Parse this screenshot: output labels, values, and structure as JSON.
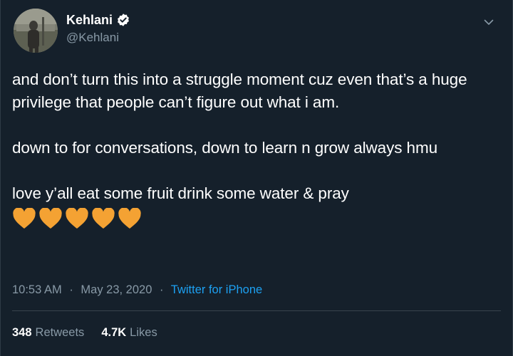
{
  "user": {
    "display_name": "Kehlani",
    "handle": "@Kehlani",
    "verified": true,
    "avatar_icon": "profile-photo"
  },
  "tweet": {
    "paragraphs": [
      "and don’t turn this into a struggle moment cuz even that’s a huge privilege that people can’t figure out what i am.",
      "down to for conversations, down to learn n grow always hmu",
      "love y’all eat some fruit drink some water & pray"
    ],
    "emoji": [
      "orange-heart",
      "orange-heart",
      "orange-heart",
      "orange-heart",
      "orange-heart"
    ],
    "time": "10:53 AM",
    "separator": "·",
    "date": "May 23, 2020",
    "source": "Twitter for iPhone"
  },
  "stats": {
    "retweets_count": "348",
    "retweets_label": "Retweets",
    "likes_count": "4.7K",
    "likes_label": "Likes"
  },
  "colors": {
    "background": "#15202b",
    "text": "#ffffff",
    "secondary": "#8899a6",
    "link": "#1da1f2",
    "divider": "#38444d",
    "heart": "#f4a233"
  }
}
